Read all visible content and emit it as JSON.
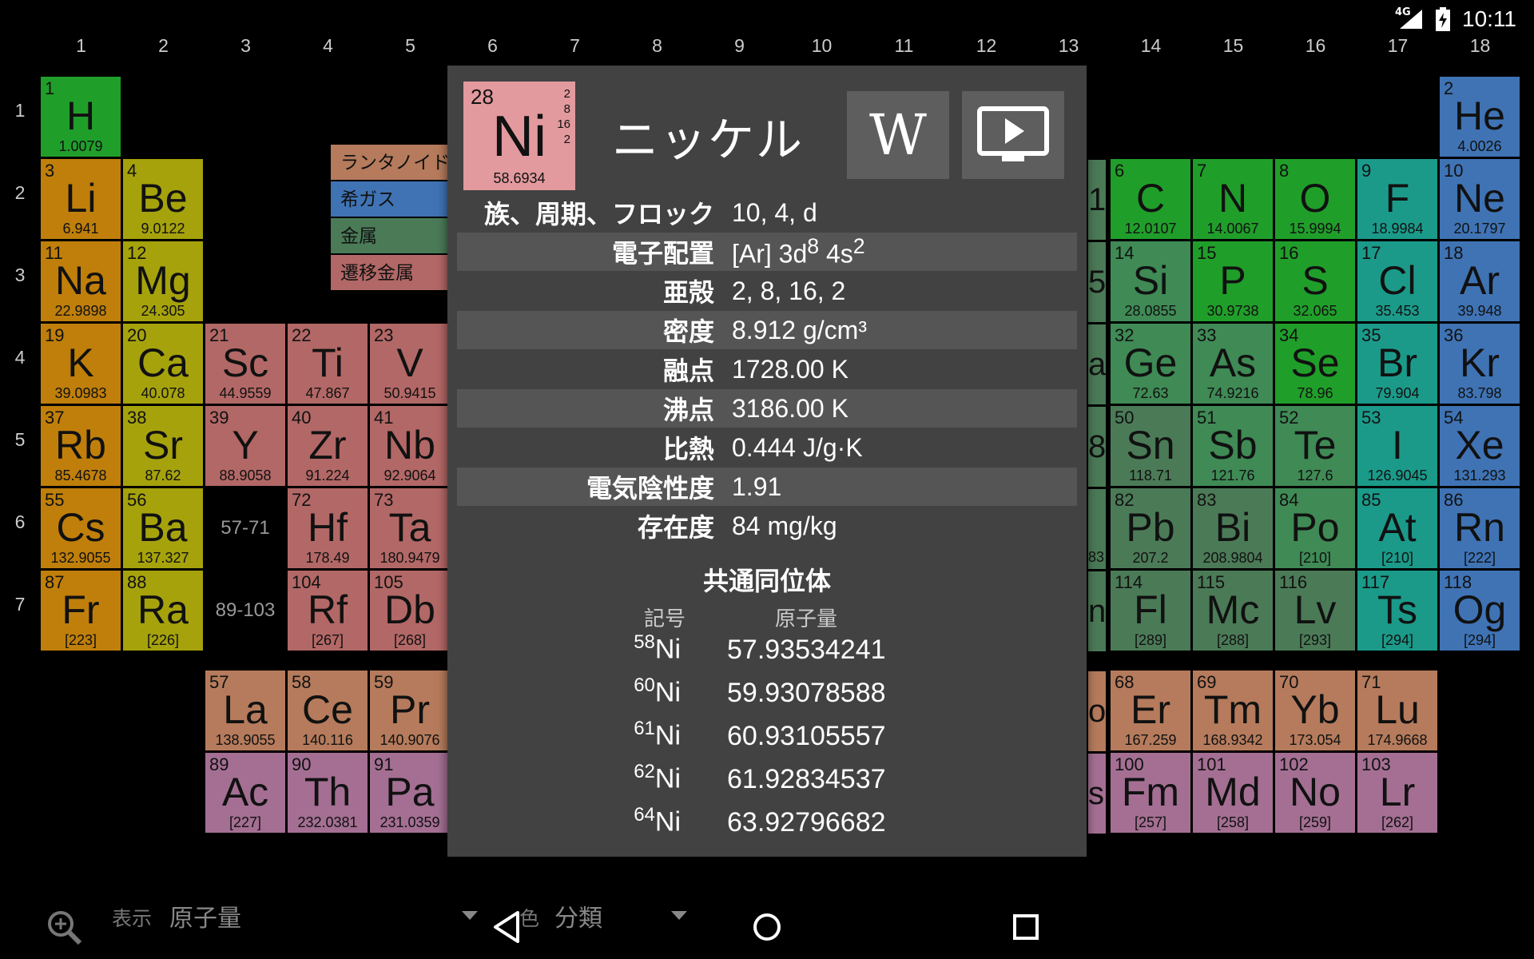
{
  "status_bar": {
    "network": "4G",
    "time": "10:11"
  },
  "groups": [
    "1",
    "2",
    "3",
    "4",
    "5",
    "6",
    "7",
    "8",
    "9",
    "10",
    "11",
    "12",
    "13",
    "14",
    "15",
    "16",
    "17",
    "18"
  ],
  "periods": [
    "1",
    "2",
    "3",
    "4",
    "5",
    "6",
    "7"
  ],
  "category_colors": {
    "alkali": "#c07f0a",
    "alkaline": "#a6a20c",
    "transition": "#b26866",
    "lanthanide": "#b57b5c",
    "actinide": "#a46f93",
    "metal": "#4b7a57",
    "metalloid": "#3f8a55",
    "nonmetal": "#209e2a",
    "halogen": "#1b9a8a",
    "noble": "#3f73b4"
  },
  "elements": [
    {
      "n": "1",
      "s": "H",
      "m": "1.0079",
      "c": "nonmetal",
      "g": 1,
      "p": 1
    },
    {
      "n": "2",
      "s": "He",
      "m": "4.0026",
      "c": "noble",
      "g": 18,
      "p": 1
    },
    {
      "n": "3",
      "s": "Li",
      "m": "6.941",
      "c": "alkali",
      "g": 1,
      "p": 2
    },
    {
      "n": "4",
      "s": "Be",
      "m": "9.0122",
      "c": "alkaline",
      "g": 2,
      "p": 2
    },
    {
      "n": "6",
      "s": "C",
      "m": "12.0107",
      "c": "nonmetal",
      "g": 14,
      "p": 2
    },
    {
      "n": "7",
      "s": "N",
      "m": "14.0067",
      "c": "nonmetal",
      "g": 15,
      "p": 2
    },
    {
      "n": "8",
      "s": "O",
      "m": "15.9994",
      "c": "nonmetal",
      "g": 16,
      "p": 2
    },
    {
      "n": "9",
      "s": "F",
      "m": "18.9984",
      "c": "halogen",
      "g": 17,
      "p": 2
    },
    {
      "n": "10",
      "s": "Ne",
      "m": "20.1797",
      "c": "noble",
      "g": 18,
      "p": 2
    },
    {
      "n": "11",
      "s": "Na",
      "m": "22.9898",
      "c": "alkali",
      "g": 1,
      "p": 3
    },
    {
      "n": "12",
      "s": "Mg",
      "m": "24.305",
      "c": "alkaline",
      "g": 2,
      "p": 3
    },
    {
      "n": "14",
      "s": "Si",
      "m": "28.0855",
      "c": "metalloid",
      "g": 14,
      "p": 3
    },
    {
      "n": "15",
      "s": "P",
      "m": "30.9738",
      "c": "nonmetal",
      "g": 15,
      "p": 3
    },
    {
      "n": "16",
      "s": "S",
      "m": "32.065",
      "c": "nonmetal",
      "g": 16,
      "p": 3
    },
    {
      "n": "17",
      "s": "Cl",
      "m": "35.453",
      "c": "halogen",
      "g": 17,
      "p": 3
    },
    {
      "n": "18",
      "s": "Ar",
      "m": "39.948",
      "c": "noble",
      "g": 18,
      "p": 3
    },
    {
      "n": "19",
      "s": "K",
      "m": "39.0983",
      "c": "alkali",
      "g": 1,
      "p": 4
    },
    {
      "n": "20",
      "s": "Ca",
      "m": "40.078",
      "c": "alkaline",
      "g": 2,
      "p": 4
    },
    {
      "n": "21",
      "s": "Sc",
      "m": "44.9559",
      "c": "transition",
      "g": 3,
      "p": 4
    },
    {
      "n": "22",
      "s": "Ti",
      "m": "47.867",
      "c": "transition",
      "g": 4,
      "p": 4
    },
    {
      "n": "23",
      "s": "V",
      "m": "50.9415",
      "c": "transition",
      "g": 5,
      "p": 4
    },
    {
      "n": "32",
      "s": "Ge",
      "m": "72.63",
      "c": "metalloid",
      "g": 14,
      "p": 4
    },
    {
      "n": "33",
      "s": "As",
      "m": "74.9216",
      "c": "metalloid",
      "g": 15,
      "p": 4
    },
    {
      "n": "34",
      "s": "Se",
      "m": "78.96",
      "c": "nonmetal",
      "g": 16,
      "p": 4
    },
    {
      "n": "35",
      "s": "Br",
      "m": "79.904",
      "c": "halogen",
      "g": 17,
      "p": 4
    },
    {
      "n": "36",
      "s": "Kr",
      "m": "83.798",
      "c": "noble",
      "g": 18,
      "p": 4
    },
    {
      "n": "37",
      "s": "Rb",
      "m": "85.4678",
      "c": "alkali",
      "g": 1,
      "p": 5
    },
    {
      "n": "38",
      "s": "Sr",
      "m": "87.62",
      "c": "alkaline",
      "g": 2,
      "p": 5
    },
    {
      "n": "39",
      "s": "Y",
      "m": "88.9058",
      "c": "transition",
      "g": 3,
      "p": 5
    },
    {
      "n": "40",
      "s": "Zr",
      "m": "91.224",
      "c": "transition",
      "g": 4,
      "p": 5
    },
    {
      "n": "41",
      "s": "Nb",
      "m": "92.9064",
      "c": "transition",
      "g": 5,
      "p": 5
    },
    {
      "n": "50",
      "s": "Sn",
      "m": "118.71",
      "c": "metal",
      "g": 14,
      "p": 5
    },
    {
      "n": "51",
      "s": "Sb",
      "m": "121.76",
      "c": "metalloid",
      "g": 15,
      "p": 5
    },
    {
      "n": "52",
      "s": "Te",
      "m": "127.6",
      "c": "metalloid",
      "g": 16,
      "p": 5
    },
    {
      "n": "53",
      "s": "I",
      "m": "126.9045",
      "c": "halogen",
      "g": 17,
      "p": 5
    },
    {
      "n": "54",
      "s": "Xe",
      "m": "131.293",
      "c": "noble",
      "g": 18,
      "p": 5
    },
    {
      "n": "55",
      "s": "Cs",
      "m": "132.9055",
      "c": "alkali",
      "g": 1,
      "p": 6
    },
    {
      "n": "56",
      "s": "Ba",
      "m": "137.327",
      "c": "alkaline",
      "g": 2,
      "p": 6
    },
    {
      "n": "72",
      "s": "Hf",
      "m": "178.49",
      "c": "transition",
      "g": 4,
      "p": 6
    },
    {
      "n": "73",
      "s": "Ta",
      "m": "180.9479",
      "c": "transition",
      "g": 5,
      "p": 6
    },
    {
      "n": "82",
      "s": "Pb",
      "m": "207.2",
      "c": "metal",
      "g": 14,
      "p": 6
    },
    {
      "n": "83",
      "s": "Bi",
      "m": "208.9804",
      "c": "metal",
      "g": 15,
      "p": 6
    },
    {
      "n": "84",
      "s": "Po",
      "m": "[210]",
      "c": "metalloid",
      "g": 16,
      "p": 6
    },
    {
      "n": "85",
      "s": "At",
      "m": "[210]",
      "c": "halogen",
      "g": 17,
      "p": 6
    },
    {
      "n": "86",
      "s": "Rn",
      "m": "[222]",
      "c": "noble",
      "g": 18,
      "p": 6
    },
    {
      "n": "87",
      "s": "Fr",
      "m": "[223]",
      "c": "alkali",
      "g": 1,
      "p": 7
    },
    {
      "n": "88",
      "s": "Ra",
      "m": "[226]",
      "c": "alkaline",
      "g": 2,
      "p": 7
    },
    {
      "n": "104",
      "s": "Rf",
      "m": "[267]",
      "c": "transition",
      "g": 4,
      "p": 7
    },
    {
      "n": "105",
      "s": "Db",
      "m": "[268]",
      "c": "transition",
      "g": 5,
      "p": 7
    },
    {
      "n": "114",
      "s": "Fl",
      "m": "[289]",
      "c": "metal",
      "g": 14,
      "p": 7
    },
    {
      "n": "115",
      "s": "Mc",
      "m": "[288]",
      "c": "metal",
      "g": 15,
      "p": 7
    },
    {
      "n": "116",
      "s": "Lv",
      "m": "[293]",
      "c": "metal",
      "g": 16,
      "p": 7
    },
    {
      "n": "117",
      "s": "Ts",
      "m": "[294]",
      "c": "halogen",
      "g": 17,
      "p": 7
    },
    {
      "n": "118",
      "s": "Og",
      "m": "[294]",
      "c": "noble",
      "g": 18,
      "p": 7
    },
    {
      "n": "57",
      "s": "La",
      "m": "138.9055",
      "c": "lanthanide",
      "g": 3,
      "p": 8
    },
    {
      "n": "58",
      "s": "Ce",
      "m": "140.116",
      "c": "lanthanide",
      "g": 4,
      "p": 8
    },
    {
      "n": "59",
      "s": "Pr",
      "m": "140.9076",
      "c": "lanthanide",
      "g": 5,
      "p": 8
    },
    {
      "n": "68",
      "s": "Er",
      "m": "167.259",
      "c": "lanthanide",
      "g": 14,
      "p": 8
    },
    {
      "n": "69",
      "s": "Tm",
      "m": "168.9342",
      "c": "lanthanide",
      "g": 15,
      "p": 8
    },
    {
      "n": "70",
      "s": "Yb",
      "m": "173.054",
      "c": "lanthanide",
      "g": 16,
      "p": 8
    },
    {
      "n": "71",
      "s": "Lu",
      "m": "174.9668",
      "c": "lanthanide",
      "g": 17,
      "p": 8
    },
    {
      "n": "89",
      "s": "Ac",
      "m": "[227]",
      "c": "actinide",
      "g": 3,
      "p": 9
    },
    {
      "n": "90",
      "s": "Th",
      "m": "232.0381",
      "c": "actinide",
      "g": 4,
      "p": 9
    },
    {
      "n": "91",
      "s": "Pa",
      "m": "231.0359",
      "c": "actinide",
      "g": 5,
      "p": 9
    },
    {
      "n": "100",
      "s": "Fm",
      "m": "[257]",
      "c": "actinide",
      "g": 14,
      "p": 9
    },
    {
      "n": "101",
      "s": "Md",
      "m": "[258]",
      "c": "actinide",
      "g": 15,
      "p": 9
    },
    {
      "n": "102",
      "s": "No",
      "m": "[259]",
      "c": "actinide",
      "g": 16,
      "p": 9
    },
    {
      "n": "103",
      "s": "Lr",
      "m": "[262]",
      "c": "actinide",
      "g": 17,
      "p": 9
    }
  ],
  "placeholders": [
    {
      "label": "57-71",
      "g": 3,
      "p": 6
    },
    {
      "label": "89-103",
      "g": 3,
      "p": 7
    }
  ],
  "legend": [
    {
      "label": "ランタノイド",
      "color": "#b57b5c"
    },
    {
      "label": "希ガス",
      "color": "#3f73b4"
    },
    {
      "label": "金属",
      "color": "#4b7a57"
    },
    {
      "label": "遷移金属",
      "color": "#b26866"
    }
  ],
  "partial_cells": [
    {
      "text": "1",
      "p": 2
    },
    {
      "text": "5",
      "p": 3
    },
    {
      "text": "a",
      "p": 4
    },
    {
      "text": "8",
      "p": 5
    },
    {
      "text": "83",
      "p": 6
    },
    {
      "text": "n",
      "p": 7
    },
    {
      "text": "o",
      "p": 8
    },
    {
      "text": "s",
      "p": 9
    }
  ],
  "bottom": {
    "display_label": "表示",
    "display_value": "原子量",
    "color_label": "色",
    "color_value": "分類"
  },
  "dialog": {
    "tile": {
      "number": "28",
      "symbol": "Ni",
      "mass": "58.6934",
      "shells": [
        "2",
        "8",
        "16",
        "2"
      ],
      "color": "#e29a9e"
    },
    "name": "ニッケル",
    "wiki_icon": "wikipedia-icon",
    "video_icon": "video-play-icon",
    "properties": [
      {
        "label": "族、周期、フロック",
        "value": "10, 4, d"
      },
      {
        "label": "電子配置",
        "value_html": "[Ar] 3d<sup>8</sup> 4s<sup>2</sup>",
        "value": "[Ar] 3d8 4s2"
      },
      {
        "label": "亜殻",
        "value": "2, 8, 16, 2"
      },
      {
        "label": "密度",
        "value": "8.912 g/cm³"
      },
      {
        "label": "融点",
        "value": "1728.00 K"
      },
      {
        "label": "沸点",
        "value": "3186.00 K"
      },
      {
        "label": "比熱",
        "value": "0.444 J/g·K"
      },
      {
        "label": "電気陰性度",
        "value": "1.91"
      },
      {
        "label": "存在度",
        "value": "84 mg/kg"
      }
    ],
    "isotopes_title": "共通同位体",
    "isotopes_head_symbol": "記号",
    "isotopes_head_mass": "原子量",
    "isotopes": [
      {
        "a": "58",
        "s": "Ni",
        "m": "57.93534241"
      },
      {
        "a": "60",
        "s": "Ni",
        "m": "59.93078588"
      },
      {
        "a": "61",
        "s": "Ni",
        "m": "60.93105557"
      },
      {
        "a": "62",
        "s": "Ni",
        "m": "61.92834537"
      },
      {
        "a": "64",
        "s": "Ni",
        "m": "63.92796682"
      }
    ]
  }
}
